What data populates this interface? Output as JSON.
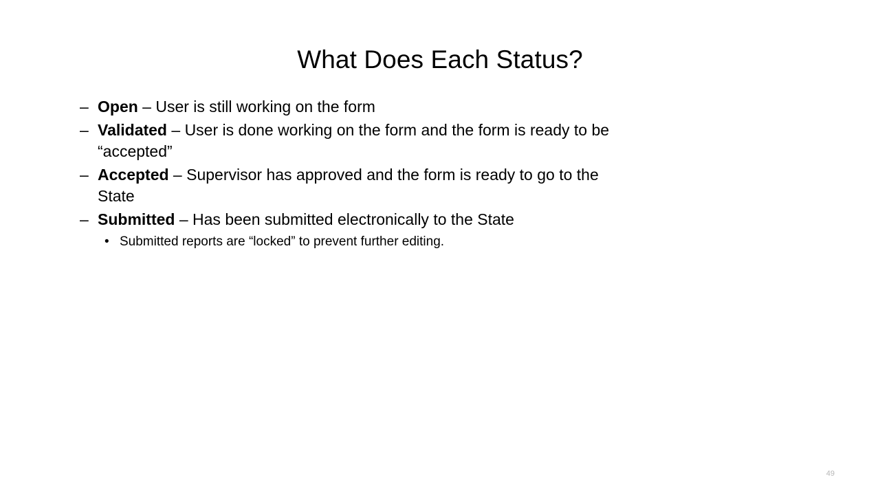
{
  "slide": {
    "title": "What Does Each Status?",
    "page_number": "49",
    "background_color": "#ffffff",
    "text_color": "#000000",
    "page_number_color": "#b6b6b6"
  },
  "bullets": [
    {
      "marker": "–",
      "term": "Open",
      "separator": " – ",
      "description": "User is still working on the form"
    },
    {
      "marker": "–",
      "term": "Validated",
      "separator": " – ",
      "description": "User is done working on the form and the form is ready to be “accepted”"
    },
    {
      "marker": "–",
      "term": "Accepted",
      "separator": " – ",
      "description": "Supervisor has approved and the form is ready to go to the State"
    },
    {
      "marker": "–",
      "term": "Submitted",
      "separator": " – ",
      "description": "Has been submitted electronically to the State"
    }
  ],
  "sub_bullet": {
    "marker": "•",
    "text": "Submitted reports are “locked” to prevent further editing."
  }
}
